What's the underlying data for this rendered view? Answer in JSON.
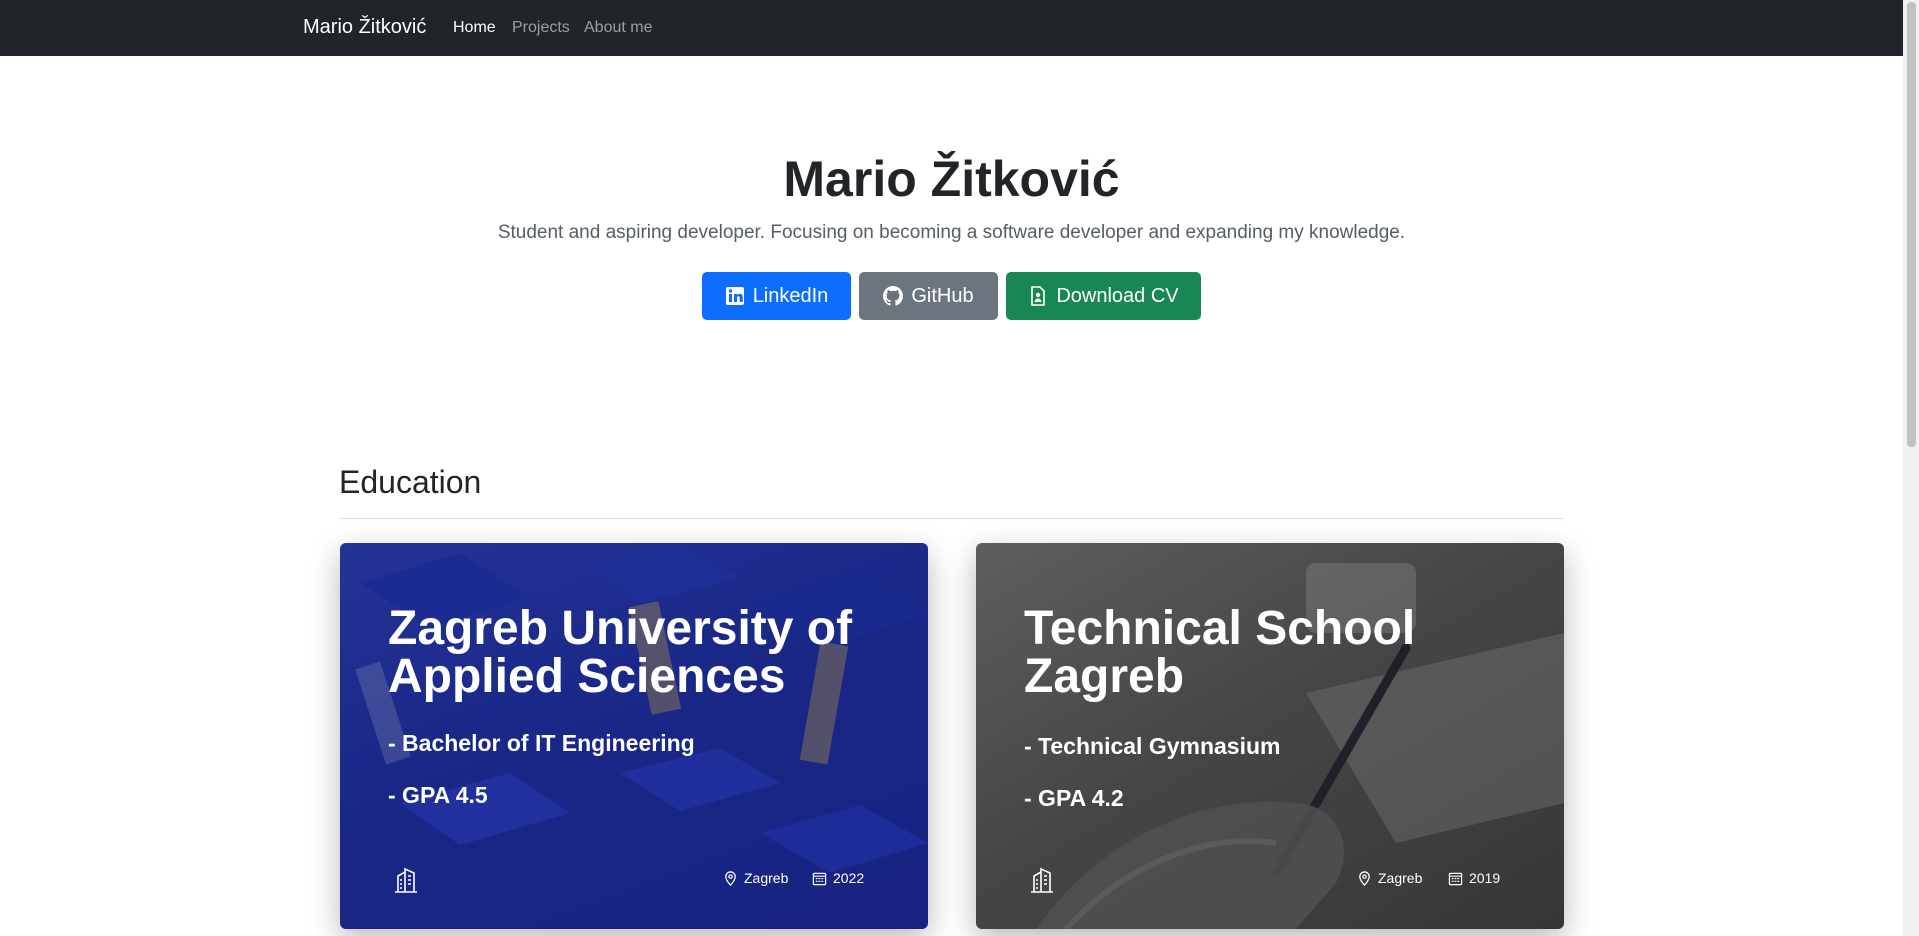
{
  "nav": {
    "brand": "Mario Žitković",
    "links": [
      {
        "label": "Home",
        "active": true
      },
      {
        "label": "Projects",
        "active": false
      },
      {
        "label": "About me",
        "active": false
      }
    ]
  },
  "hero": {
    "title": "Mario Žitković",
    "lead": "Student and aspiring developer. Focusing on becoming a software developer and expanding my knowledge.",
    "buttons": [
      {
        "label": "LinkedIn",
        "icon": "linkedin-icon",
        "color": "#0d6efd"
      },
      {
        "label": "GitHub",
        "icon": "github-icon",
        "color": "#6c757d"
      },
      {
        "label": "Download CV",
        "icon": "file-icon",
        "color": "#198754"
      }
    ]
  },
  "education": {
    "title": "Education",
    "cards": [
      {
        "title": "Zagreb University of Applied Sciences",
        "lines": [
          "- Bachelor of IT Engineering",
          "- GPA 4.5"
        ],
        "location": "Zagreb",
        "year": "2022",
        "icons": [
          "building-icon",
          "location-pin-icon",
          "calendar-icon"
        ]
      },
      {
        "title": "Technical School Zagreb",
        "lines": [
          "- Technical Gymnasium",
          "- GPA 4.2"
        ],
        "location": "Zagreb",
        "year": "2019",
        "icons": [
          "building-icon",
          "location-pin-icon",
          "calendar-icon"
        ]
      }
    ]
  }
}
